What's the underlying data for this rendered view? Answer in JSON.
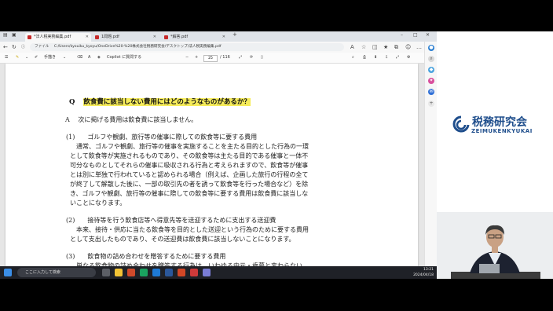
{
  "browser": {
    "tabs": [
      {
        "label": "*法人税実務編集.pdf"
      },
      {
        "label": "1問題.pdf"
      },
      {
        "label": "*解答.pdf"
      }
    ],
    "new_tab": "+",
    "file_label": "ファイル",
    "url": "C:/Users/kyouiku_kyoyu/OneDrive%20-%20株式会社税務研究会/デスクトップ/法人税実務編集.pdf"
  },
  "pdf_toolbar": {
    "handwrite_label": "手描き",
    "copilot_label": "Copilot に質問する",
    "page_current": "25",
    "page_total": "/ 116"
  },
  "document": {
    "q_marker": "Q",
    "question": "飲食費に該当しない費用にはどのようなものがあるか？",
    "a_marker": "A",
    "answer": "次に掲げる費用は飲食費に該当しません。",
    "lines": [
      "(1)　　ゴルフや観劇、旅行等の催事に際しての飲食等に要する費用",
      "　通常、ゴルフや観劇、旅行等の催事を実施することを主たる目的とした行為の一環",
      "として飲食等が実施されるものであり、その飲食等は主たる目的である催事と一体不",
      "可分なものとしてそれらの催事に吸収される行為と考えられますので、飲食等が催事",
      "とは別に単独で行われていると認められる場合（例えば、企画した旅行の行程の全て",
      "が終了して解散した後に、一部の取引先の者を誘って飲食等を行った場合など）を除",
      "き、ゴルフや観劇、旅行等の催事に際しての飲食等に要する費用は飲食費に該当しな",
      "いことになります。",
      "(2)　　接待等を行う飲食店等へ得意先等を送迎するために支出する送迎費",
      "　本来、接待・供応に当たる飲食等を目的とした送迎という行為のために要する費用",
      "として支出したものであり、その送迎費は飲食費に該当しないことになります。",
      "(3)　　飲食物の詰め合わせを贈答するために要する費用",
      "　単なる飲食物の詰め合わせを贈答する行為は、いわゆる中元・歳暮と変わらない"
    ]
  },
  "taskbar": {
    "search_placeholder": "ここに入力して検索",
    "time": "13:21",
    "date": "2024/04/18"
  },
  "logo": {
    "main": "税務研究会",
    "sub": "ZEIMUKENKYUKAI"
  },
  "colors": {
    "highlight": "#f6ec5a",
    "brand": "#1f4e8c"
  }
}
